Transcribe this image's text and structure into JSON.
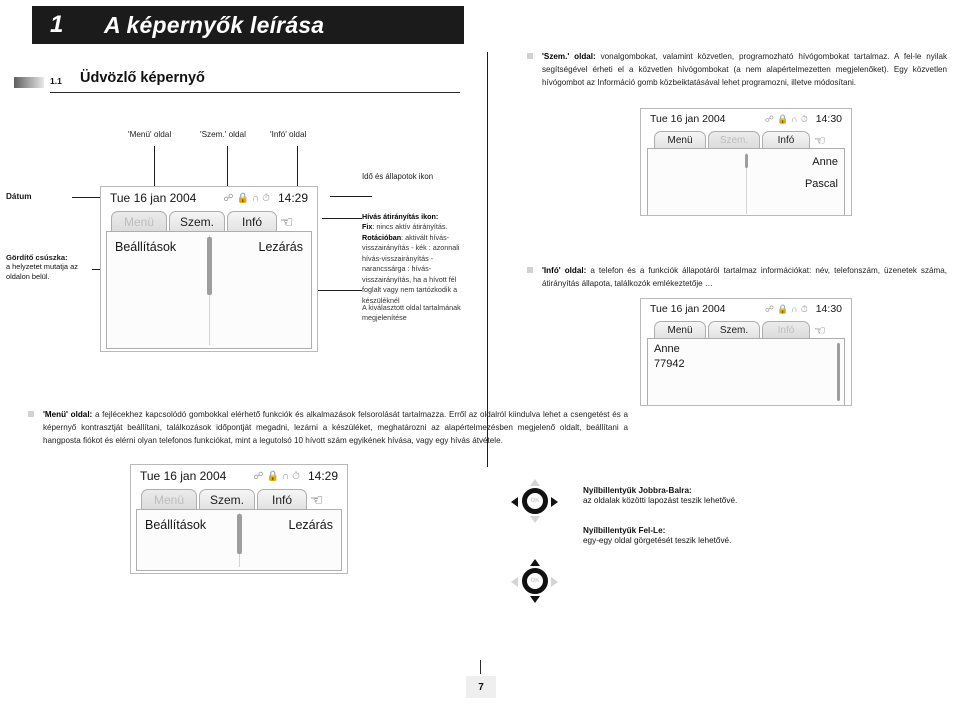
{
  "chapter": {
    "number": "1",
    "title": "A képernyők leírása"
  },
  "section": {
    "number": "1.1",
    "title": "Üdvözlő képernyő"
  },
  "notes": {
    "szem_page": "'Szem.' oldal: vonalgombokat, valamint közvetlen, programozható hívógombokat tartalmaz. A fel-le nyilak segítségével érheti el a közvetlen hívógombokat (a nem alapértelmezetten megjelenőket). Egy közvetlen hívógombot az Információ gomb közbeiktatásával lehet programozni, illetve módosítani.",
    "szem_bold": "'Szem.' oldal:",
    "info_page": "'Infó' oldal: a telefon és a funkciók állapotáról tartalmaz információkat: név, telefonszám, üzenetek száma, átirányítás állapota, találkozók emlékeztetője …",
    "info_bold": "'Infó' oldal:",
    "menu_page": "'Menü' oldal: a fejlécekhez kapcsolódó gombokkal elérhető funkciók és alkalmazások felsorolását tartalmazza. Erről az oldalról kiindulva lehet a csengetést és a képernyő kontrasztját beállítani, találkozások időpontját megadni, lezárni a készüléket, meghatározni az alapértelmezésben megjelenő oldalt, beállítani a hangposta fiókot és elérni olyan telefonos funkciókat, mint a legutolsó 10 hívott szám egyikének hívása, vagy egy hívás átvétele.",
    "menu_bold": "'Menü' oldal:"
  },
  "page_labels": {
    "menu": "'Menü' oldal",
    "szem": "'Szem.' oldal",
    "info": "'Infó' oldal"
  },
  "callouts": {
    "datum": "Dátum",
    "scroll_title": "Gördítő csúszka:",
    "scroll_text": "a helyzetet mutatja az oldalon belül.",
    "status_icons": "Idő és állapotok ikon",
    "divert_title": "Hívás átirányítás ikon:",
    "divert_fix_b": "Fix",
    "divert_fix": ": nincs aktív átirányítás.",
    "divert_rot_b": "Rotációban",
    "divert_rot": ": aktivált hívás-visszairányítás - kék : azonnali hívás-visszairányítás - narancssárga : hívás-visszairányítás, ha a hívott fél foglalt vagy nem tartózkodik a készüléknél",
    "selected_page": "A kiválasztott oldal tartalmának megjelenítése"
  },
  "screens": {
    "menu_small": {
      "date": "Tue 16 jan 2004",
      "time": "14:30",
      "tabs": [
        {
          "label": "Menü",
          "state": "active"
        },
        {
          "label": "Szem.",
          "state": "inactive"
        },
        {
          "label": "Infó",
          "state": "active"
        }
      ],
      "items_right": [
        "Anne",
        "Pascal"
      ]
    },
    "menu_large": {
      "date": "Tue 16 jan 2004",
      "time": "14:29",
      "tabs": [
        {
          "label": "Menü",
          "state": "inactive"
        },
        {
          "label": "Szem.",
          "state": "active"
        },
        {
          "label": "Infó",
          "state": "active"
        }
      ],
      "item_left": "Beállítások",
      "item_right": "Lezárás"
    },
    "info_small": {
      "date": "Tue 16 jan 2004",
      "time": "14:30",
      "tabs": [
        {
          "label": "Menü",
          "state": "active"
        },
        {
          "label": "Szem.",
          "state": "active"
        },
        {
          "label": "Infó",
          "state": "inactive"
        }
      ],
      "items_left": [
        "Anne",
        "77942"
      ]
    },
    "menu_bottom": {
      "date": "Tue 16 jan 2004",
      "time": "14:29",
      "tabs": [
        {
          "label": "Menü",
          "state": "inactive"
        },
        {
          "label": "Szem.",
          "state": "active"
        },
        {
          "label": "Infó",
          "state": "active"
        }
      ],
      "item_left": "Beállítások",
      "item_right": "Lezárás"
    }
  },
  "nav_keys": [
    {
      "title": "Nyílbillentyűk Jobbra-Balra:",
      "text": "az oldalak közötti lapozást teszik lehetővé.",
      "ok_label": "OK"
    },
    {
      "title": "Nyílbillentyűk Fel-Le:",
      "text": "egy-egy oldal görgetését teszik lehetővé.",
      "ok_label": "OK"
    }
  ],
  "footer": {
    "page_number": "7"
  },
  "icons": {
    "divert": "call-divert-icon",
    "lock": "lock-icon",
    "headset": "headset-icon",
    "clock": "clock-icon",
    "hand_cursor": "hand-cursor-icon"
  },
  "colors": {
    "banner_bg": "#1b1b1b",
    "rule": "#1d1d1d",
    "tab_inactive_text": "#bdbdbd",
    "bullet_mark": "#d2d2d2"
  }
}
